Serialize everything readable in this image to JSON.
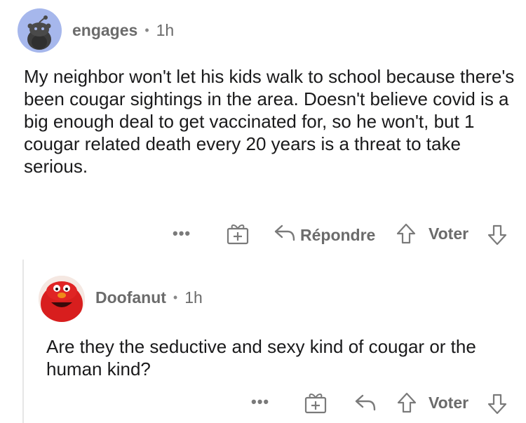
{
  "comment1": {
    "username": "engages",
    "separator": "•",
    "time": "1h",
    "body": "My neighbor won't let his kids walk to school because there's been cougar sightings in the area. Doesn't believe covid is a big enough deal to get vaccinated for, so he won't, but 1 cougar related death every 20 years is a threat to take serious.",
    "actions": {
      "more": "•••",
      "reply_label": "Répondre",
      "vote_label": "Voter"
    }
  },
  "comment2": {
    "username": "Doofanut",
    "separator": "•",
    "time": "1h",
    "body": "Are they the seductive and sexy kind of cougar or the human kind?",
    "actions": {
      "more": "•••",
      "vote_label": "Voter"
    }
  },
  "colors": {
    "avatar1_bg": "#a6b7ec",
    "avatar2_accent": "#d81e1e",
    "icon_gray": "#7a7a7a"
  },
  "icons": [
    "reddit-snoo-avatar",
    "elmo-avatar",
    "award-gift-icon",
    "reply-arrow-icon",
    "upvote-arrow-icon",
    "downvote-arrow-icon"
  ]
}
